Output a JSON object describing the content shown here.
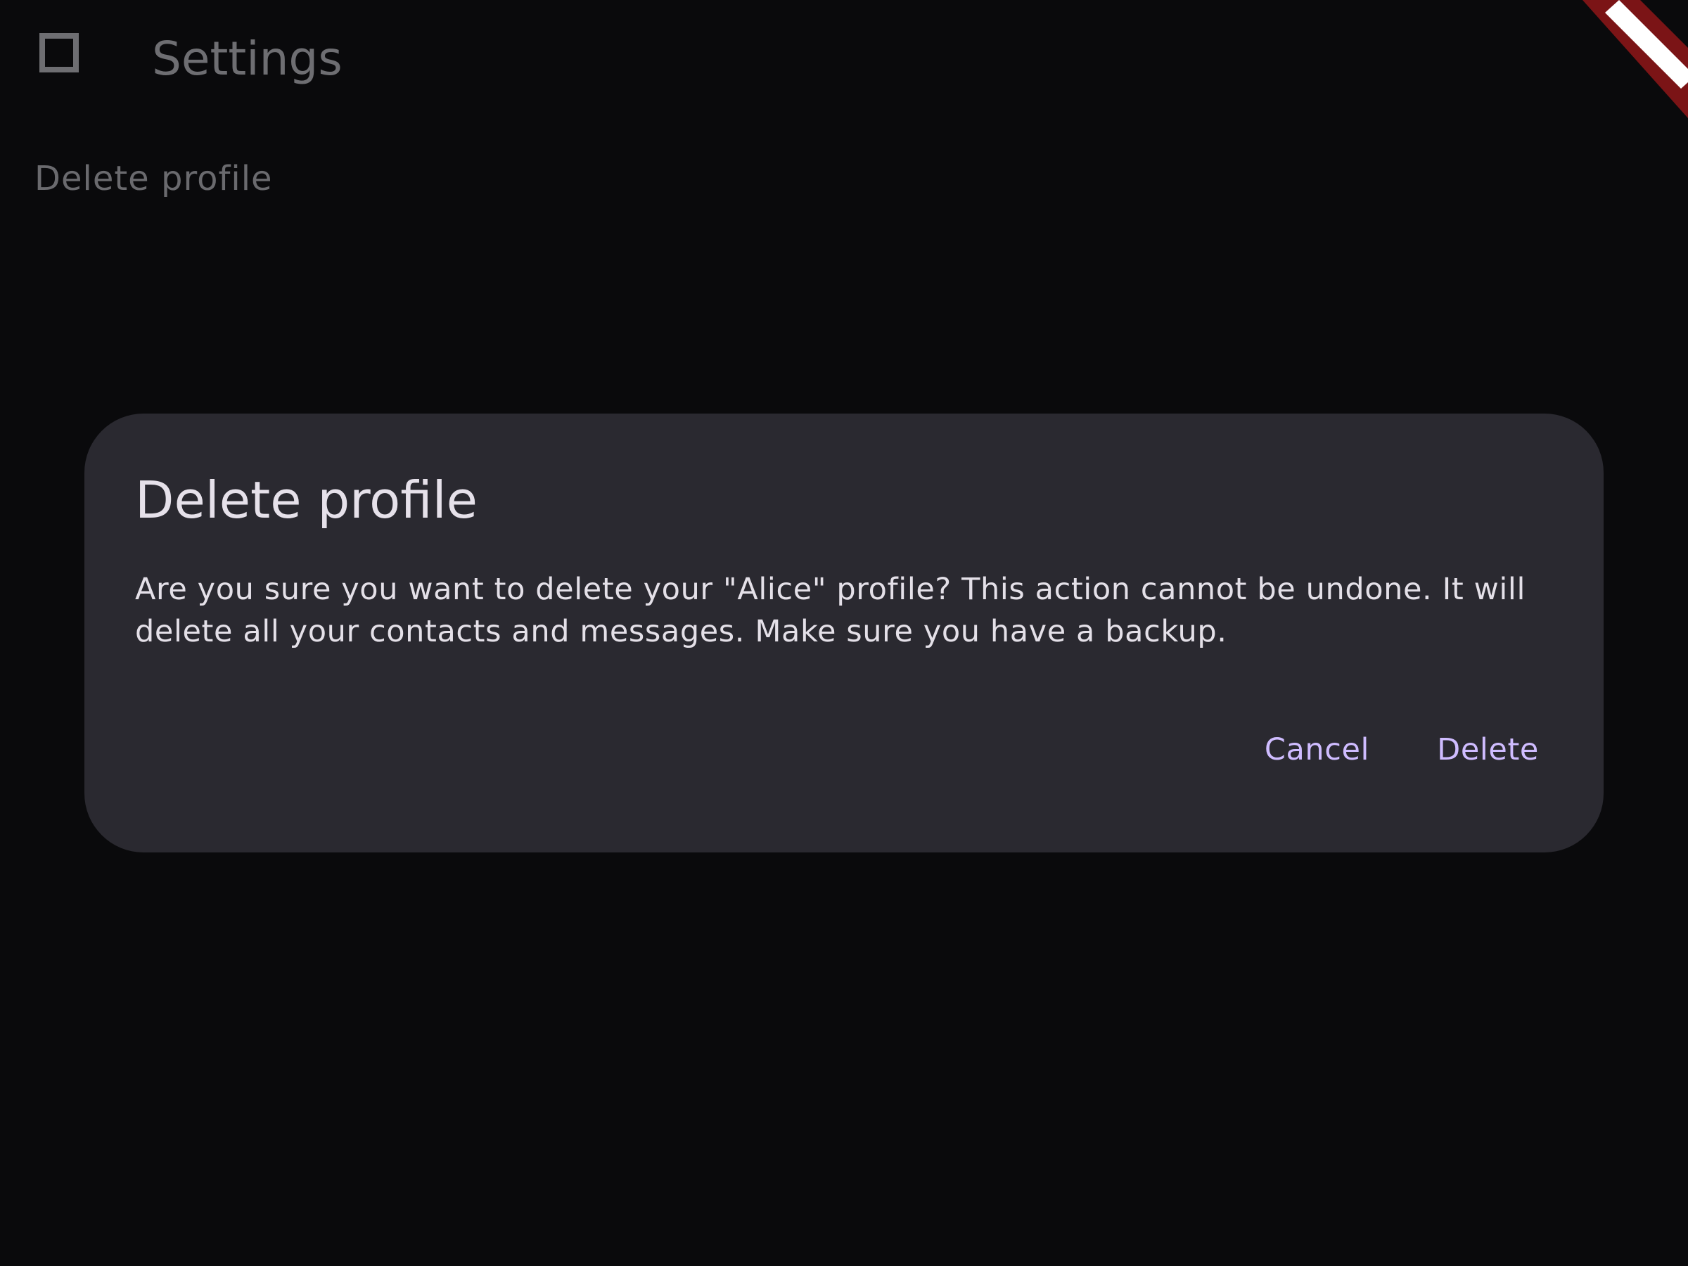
{
  "header": {
    "back_icon": "square-back-icon",
    "title": "Settings"
  },
  "settings": {
    "items": [
      {
        "label": "Delete profile"
      }
    ]
  },
  "dialog": {
    "title": "Delete profile",
    "body": "Are you sure you want to delete your \"Alice\" profile? This action cannot be undone. It will delete all your contacts and messages. Make sure you have a backup.",
    "cancel_label": "Cancel",
    "delete_label": "Delete"
  },
  "debug_banner": {
    "icon": "debug-ribbon-icon"
  },
  "colors": {
    "background": "#0a0a0c",
    "dialog_surface": "#2a2930",
    "accent": "#cfbcff",
    "banner_red": "#7b1416"
  }
}
